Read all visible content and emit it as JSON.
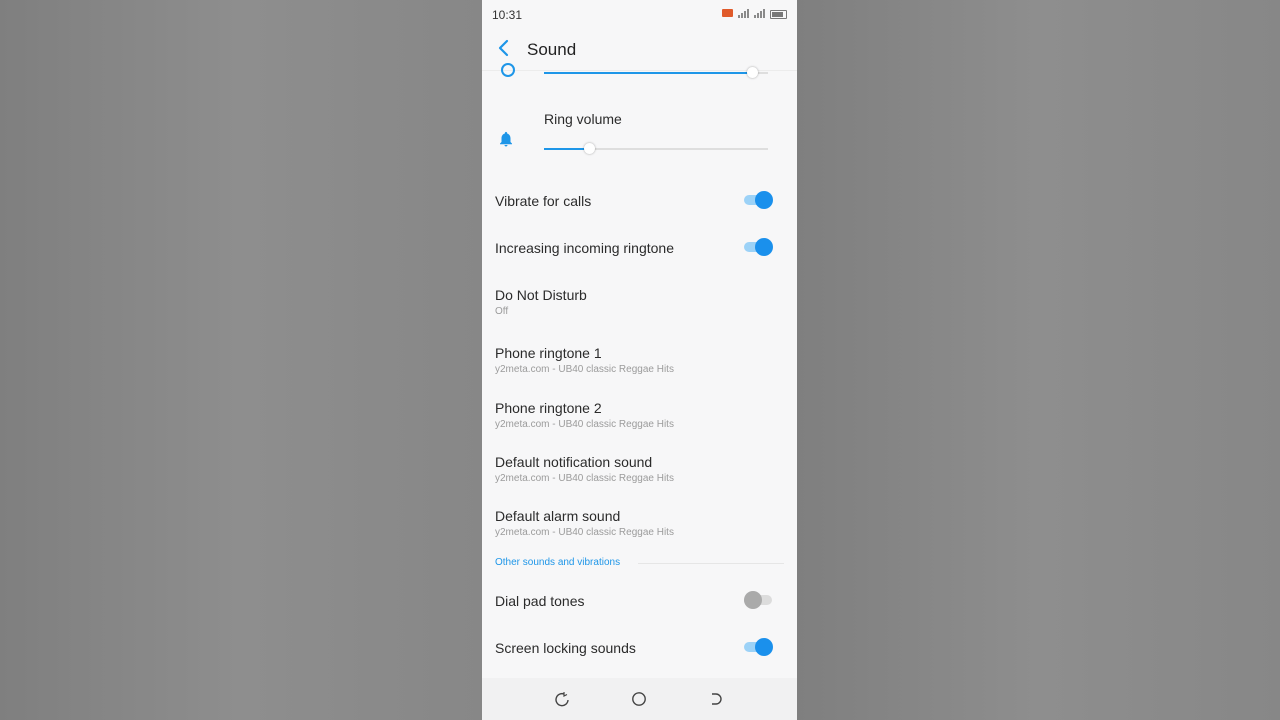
{
  "status_bar": {
    "time": "10:31",
    "icons": [
      "message-icon",
      "signal-icon",
      "signal-icon",
      "battery-icon"
    ]
  },
  "header": {
    "title": "Sound",
    "back_icon": "chevron-left-icon"
  },
  "media_volume": {
    "level": 0.93
  },
  "ring_volume": {
    "label": "Ring volume",
    "icon": "bell-icon",
    "level": 0.2
  },
  "settings": [
    {
      "label": "Vibrate for calls",
      "toggle": true
    },
    {
      "label": "Increasing incoming ringtone",
      "toggle": true
    },
    {
      "label": "Do Not Disturb",
      "subtitle": "Off"
    },
    {
      "label": "Phone ringtone 1",
      "subtitle": "y2meta.com - UB40 classic Reggae Hits"
    },
    {
      "label": "Phone ringtone 2",
      "subtitle": "y2meta.com - UB40 classic Reggae Hits"
    },
    {
      "label": "Default notification sound",
      "subtitle": "y2meta.com - UB40 classic Reggae Hits"
    },
    {
      "label": "Default alarm sound",
      "subtitle": "y2meta.com - UB40 classic Reggae Hits"
    }
  ],
  "section": {
    "label": "Other sounds and vibrations"
  },
  "other_settings": [
    {
      "label": "Dial pad tones",
      "toggle": false
    },
    {
      "label": "Screen locking sounds",
      "toggle": true
    }
  ],
  "navbar": {
    "buttons": [
      "recent-apps-icon",
      "home-icon",
      "back-nav-icon"
    ]
  },
  "colors": {
    "accent": "#1e96e8",
    "toggle_on": "#1a90ec",
    "background": "#f7f7f8"
  }
}
